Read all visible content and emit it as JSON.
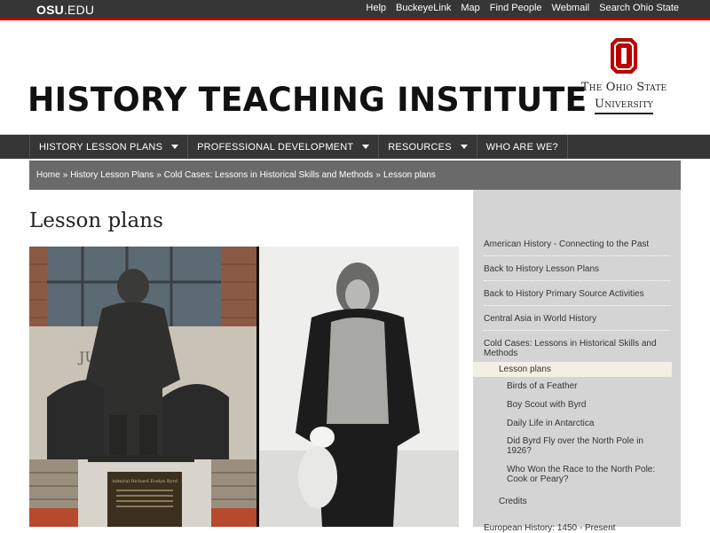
{
  "top_bar": {
    "logo_bold": "OSU",
    "logo_light": ".EDU",
    "links": [
      "Help",
      "BuckeyeLink",
      "Map",
      "Find People",
      "Webmail",
      "Search Ohio State"
    ]
  },
  "header": {
    "site_title": "HISTORY TEACHING INSTITUTE",
    "university_line1": "The Ohio State",
    "university_line2": "University"
  },
  "nav": {
    "items": [
      {
        "label": "HISTORY LESSON PLANS",
        "has_caret": true
      },
      {
        "label": "PROFESSIONAL DEVELOPMENT",
        "has_caret": true
      },
      {
        "label": "RESOURCES",
        "has_caret": true
      },
      {
        "label": "WHO ARE WE?",
        "has_caret": false
      }
    ]
  },
  "breadcrumb": [
    "Home",
    "History Lesson Plans",
    "Cold Cases: Lessons in Historical Skills and Methods",
    "Lesson plans"
  ],
  "breadcrumb_separator": "»",
  "main": {
    "page_title": "Lesson plans",
    "photo_plaque_title": "Admiral Richard Evelyn Byrd",
    "photo_building_text": "JUD"
  },
  "sidebar": {
    "links": [
      "American History - Connecting to the Past",
      "Back to History Lesson Plans",
      "Back to History Primary Source Activities",
      "Central Asia in World History",
      "Cold Cases: Lessons in Historical Skills and Methods"
    ],
    "active": "Lesson plans",
    "sub_items": [
      "Birds of a Feather",
      "Boy Scout with Byrd",
      "Daily Life in Antarctica",
      "Did Byrd Fly over the North Pole in 1926?",
      "Who Won the Race to the North Pole: Cook or Peary?"
    ],
    "credits": "Credits",
    "cut_off_item": "European History: 1450 - Present"
  }
}
